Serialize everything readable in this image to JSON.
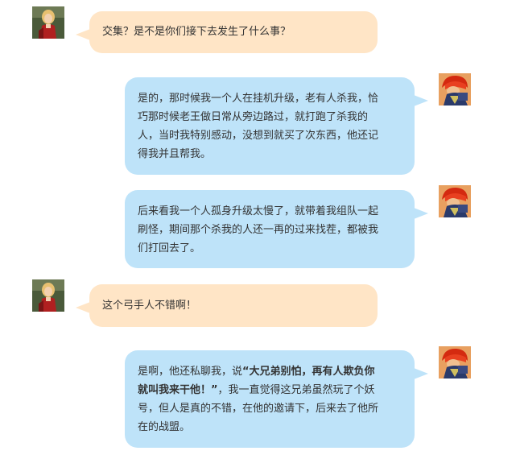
{
  "avatars": {
    "archer": "archer-avatar",
    "red_hair": "red-hair-warrior-avatar"
  },
  "colors": {
    "left_bubble": "#ffe5c6",
    "right_bubble": "#bee3f9",
    "text": "#333333"
  },
  "messages": [
    {
      "side": "left",
      "avatar": "archer",
      "text": "交集？是不是你们接下去发生了什么事？"
    },
    {
      "side": "right",
      "avatar": "red_hair",
      "lines": [
        "是的，那时候我一个人在挂机升级，老有人杀我，恰",
        "巧那时候老王做日常从旁边路过，就打跑了杀我的",
        "人，当时我特别感动，没想到就买了次东西，他还记",
        "得我并且帮我。"
      ]
    },
    {
      "side": "right",
      "avatar": "red_hair",
      "lines": [
        "后来看我一个人孤身升级太慢了，就带着我组队一起",
        "刷怪，期间那个杀我的人还一再的过来找茬，都被我",
        "们打回去了。"
      ]
    },
    {
      "side": "left",
      "avatar": "archer",
      "text": "这个弓手人不错啊！"
    },
    {
      "side": "right",
      "avatar": "red_hair",
      "prefix": "是啊，他还私聊我，说",
      "quote": "“大兄弟别怕，再有人欺负你就叫我来干他！”",
      "quote_line1": "“大兄弟别怕，再有人欺负你",
      "quote_line2": "就叫我来干他！”",
      "suffix_line2": "，我一直觉得这兄弟虽然玩了个妖",
      "line3": "号，但人是真的不错，在他的邀请下，后来去了他所",
      "line4": "在的战盟。"
    }
  ]
}
